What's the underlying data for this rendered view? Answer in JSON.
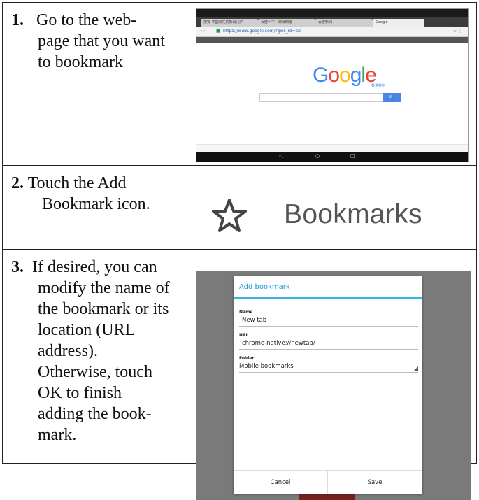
{
  "steps": [
    {
      "num": "1.",
      "lines": [
        "Go to the web-",
        "page that you want",
        "to bookmark"
      ]
    },
    {
      "num": "2.",
      "lines": [
        "Touch the Add",
        "Bookmark icon."
      ]
    },
    {
      "num": "3.",
      "lines": [
        "If desired, you can",
        "modify the name of",
        "the bookmark or its",
        "location (URL",
        "address).",
        "Otherwise, touch",
        "OK to finish",
        "adding the book-",
        "mark."
      ]
    }
  ],
  "browser": {
    "url": "https://www.google.com/?gws_rd=ssl",
    "tabs": [
      "搜狐 中国领先的新闻门户",
      "百度一下，你就知道",
      "百度新闻",
      "Google"
    ],
    "logo": [
      "G",
      "o",
      "o",
      "g",
      "l",
      "e"
    ],
    "logo_colors": [
      "#4285f4",
      "#ea4335",
      "#fbbc05",
      "#4285f4",
      "#34a853",
      "#ea4335"
    ],
    "logo_sub": "香港特别",
    "nav_icons": [
      "◁",
      "○",
      "□"
    ]
  },
  "bookmark_label": "Bookmarks",
  "dialog": {
    "title": "Add bookmark",
    "name_label": "Name",
    "name_value": "New tab",
    "url_label": "URL",
    "url_value": "chrome-native://newtab/",
    "folder_label": "Folder",
    "folder_value": "Mobile bookmarks",
    "cancel": "Cancel",
    "save": "Save"
  }
}
